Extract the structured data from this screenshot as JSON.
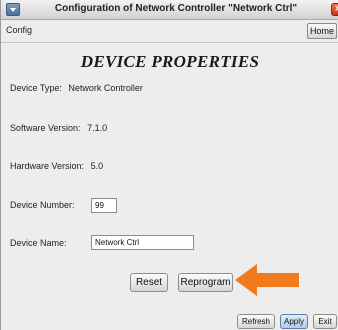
{
  "window": {
    "title": "Configuration of Network Controller \"Network Ctrl\"",
    "close_glyph": "×"
  },
  "toolbar": {
    "config_label": "Config",
    "home_label": "Home"
  },
  "main": {
    "heading": "DEVICE PROPERTIES",
    "device_type": {
      "label": "Device Type:",
      "value": "Network Controller"
    },
    "software_version": {
      "label": "Software Version:",
      "value": "7.1.0"
    },
    "hardware_version": {
      "label": "Hardware Version:",
      "value": "5.0"
    },
    "device_number": {
      "label": "Device Number:",
      "value": "99"
    },
    "device_name": {
      "label": "Device Name:",
      "value": "Network Ctrl"
    },
    "reset_label": "Reset",
    "reprogram_label": "Reprogram"
  },
  "footer": {
    "refresh_label": "Refresh",
    "apply_label": "Apply",
    "exit_label": "Exit"
  },
  "colors": {
    "annotation_arrow": "#f07a1c",
    "apply_button": "#b3cbe7",
    "close_button": "#d9432a"
  },
  "icons": {
    "window_menu": "window-menu-icon",
    "close": "close-icon",
    "annotation": "orange-arrow-icon"
  }
}
